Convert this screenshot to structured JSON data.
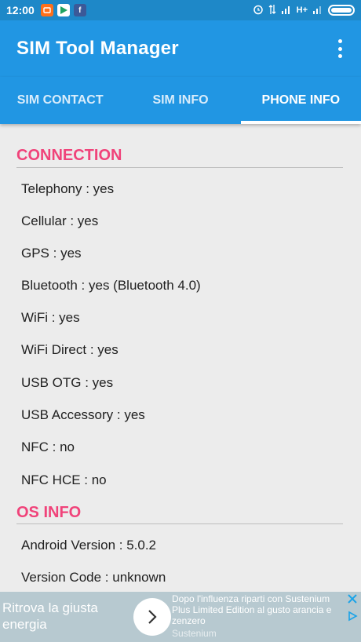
{
  "status_bar": {
    "time": "12:00",
    "network_label": "H+"
  },
  "app_bar": {
    "title": "SIM Tool Manager"
  },
  "tabs": [
    {
      "label": "SIM CONTACT",
      "active": false
    },
    {
      "label": "SIM INFO",
      "active": false
    },
    {
      "label": "PHONE INFO",
      "active": true
    }
  ],
  "sections": {
    "connection": {
      "title": "CONNECTION",
      "rows": [
        "Telephony : yes",
        "Cellular : yes",
        "GPS : yes",
        "Bluetooth : yes (Bluetooth 4.0)",
        "WiFi : yes",
        "WiFi Direct : yes",
        "USB OTG : yes",
        "USB Accessory : yes",
        "NFC : no",
        "NFC HCE : no"
      ]
    },
    "os_info": {
      "title": "OS INFO",
      "rows": [
        "Android Version : 5.0.2",
        "Version Code : unknown"
      ]
    }
  },
  "ad": {
    "headline": "Ritrova la giusta energia",
    "body": "Dopo l'influenza riparti con Sustenium Plus Limited Edition al gusto arancia e zenzero",
    "sponsor": "Sustenium"
  },
  "colors": {
    "app_bar": "#2196e3",
    "status_bar": "#1e88c8",
    "section_title": "#f0437a",
    "background": "#ececec"
  }
}
